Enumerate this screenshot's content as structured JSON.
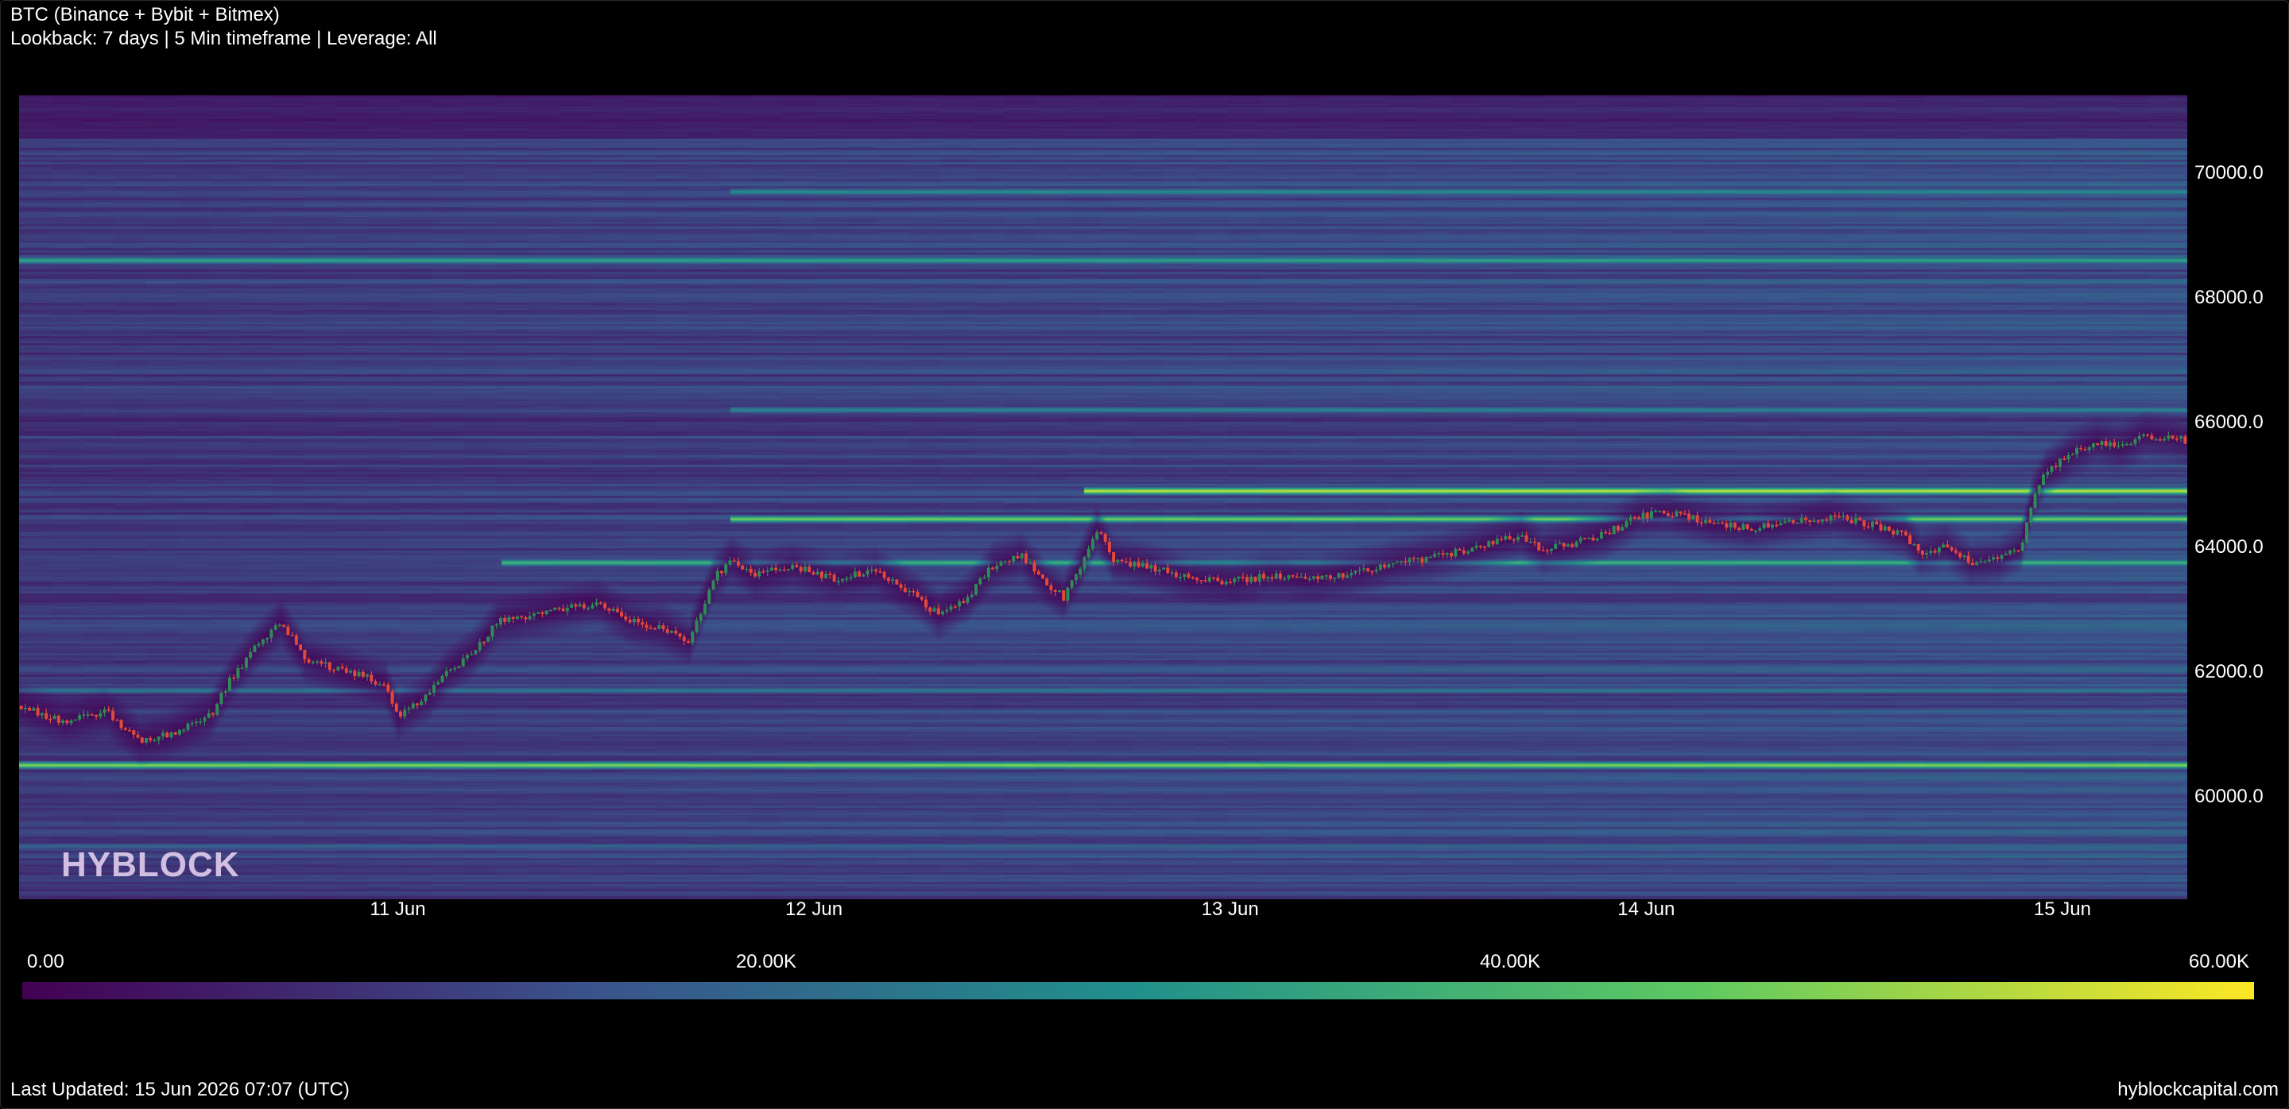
{
  "header": {
    "title": "BTC (Binance + Bybit + Bitmex)",
    "subtitle": "Lookback: 7 days | 5 Min timeframe | Leverage: All"
  },
  "brand": {
    "watermark": "HYBLOCK",
    "site": "hyblockcapital.com"
  },
  "footer": {
    "last_updated": "Last Updated: 15 Jun 2026 07:07 (UTC)"
  },
  "colors": {
    "background": "#000000",
    "scale": [
      "#440154",
      "#3b528b",
      "#21918c",
      "#5ec962",
      "#fde725"
    ],
    "candle_up": "#2e8b57",
    "candle_down": "#e04a3a"
  },
  "chart_data": {
    "type": "heatmap",
    "title": "BTC (Binance + Bybit + Bitmex)",
    "subtitle": "Lookback: 7 days | 5 Min timeframe | Leverage: All",
    "x_ticks": [
      "11 Jun",
      "12 Jun",
      "13 Jun",
      "14 Jun",
      "15 Jun"
    ],
    "x_tick_days": [
      11,
      12,
      13,
      14,
      15
    ],
    "xlim_days": [
      10.09,
      15.3
    ],
    "y_ticks": [
      "70000.0",
      "68000.0",
      "66000.0",
      "64000.0",
      "62000.0",
      "60000.0"
    ],
    "y_tick_values": [
      70000,
      68000,
      66000,
      64000,
      62000,
      60000
    ],
    "ylim": [
      58350,
      71250
    ],
    "y_axis_position": "right",
    "grid": false,
    "colorbar": {
      "min": 0,
      "max": 60000,
      "ticks": [
        "0.00",
        "20.00K",
        "40.00K",
        "60.00K"
      ],
      "tick_values": [
        0,
        20000,
        40000,
        60000
      ],
      "colormap": "viridis",
      "placement": "bottom"
    },
    "price_path": [
      [
        10.09,
        61450
      ],
      [
        10.2,
        61200
      ],
      [
        10.3,
        61350
      ],
      [
        10.38,
        60900
      ],
      [
        10.45,
        61000
      ],
      [
        10.55,
        61300
      ],
      [
        10.6,
        61900
      ],
      [
        10.66,
        62400
      ],
      [
        10.72,
        62800
      ],
      [
        10.78,
        62200
      ],
      [
        10.88,
        62000
      ],
      [
        10.97,
        61800
      ],
      [
        11.0,
        61300
      ],
      [
        11.07,
        61600
      ],
      [
        11.12,
        62000
      ],
      [
        11.18,
        62300
      ],
      [
        11.24,
        62800
      ],
      [
        11.32,
        62900
      ],
      [
        11.4,
        63000
      ],
      [
        11.48,
        63100
      ],
      [
        11.56,
        62800
      ],
      [
        11.64,
        62700
      ],
      [
        11.7,
        62500
      ],
      [
        11.76,
        63500
      ],
      [
        11.8,
        63800
      ],
      [
        11.86,
        63550
      ],
      [
        11.95,
        63700
      ],
      [
        12.05,
        63500
      ],
      [
        12.15,
        63600
      ],
      [
        12.25,
        63200
      ],
      [
        12.3,
        62900
      ],
      [
        12.37,
        63200
      ],
      [
        12.43,
        63700
      ],
      [
        12.5,
        63850
      ],
      [
        12.56,
        63400
      ],
      [
        12.6,
        63200
      ],
      [
        12.64,
        63700
      ],
      [
        12.68,
        64300
      ],
      [
        12.72,
        63800
      ],
      [
        12.8,
        63700
      ],
      [
        12.9,
        63500
      ],
      [
        13.0,
        63450
      ],
      [
        13.1,
        63550
      ],
      [
        13.2,
        63500
      ],
      [
        13.3,
        63600
      ],
      [
        13.4,
        63750
      ],
      [
        13.5,
        63850
      ],
      [
        13.6,
        64000
      ],
      [
        13.7,
        64200
      ],
      [
        13.75,
        63950
      ],
      [
        13.82,
        64050
      ],
      [
        13.9,
        64200
      ],
      [
        13.94,
        64350
      ],
      [
        13.98,
        64500
      ],
      [
        14.05,
        64550
      ],
      [
        14.15,
        64400
      ],
      [
        14.25,
        64300
      ],
      [
        14.35,
        64400
      ],
      [
        14.45,
        64500
      ],
      [
        14.55,
        64350
      ],
      [
        14.62,
        64200
      ],
      [
        14.66,
        63900
      ],
      [
        14.72,
        64000
      ],
      [
        14.78,
        63750
      ],
      [
        14.85,
        63800
      ],
      [
        14.9,
        64000
      ],
      [
        14.93,
        64800
      ],
      [
        14.96,
        65200
      ],
      [
        15.02,
        65500
      ],
      [
        15.08,
        65700
      ],
      [
        15.14,
        65600
      ],
      [
        15.2,
        65800
      ],
      [
        15.26,
        65750
      ],
      [
        15.3,
        65700
      ]
    ],
    "liquidation_bands": [
      {
        "price": 60500,
        "value": 50000,
        "from_day": 10.09
      },
      {
        "price": 64900,
        "value": 57000,
        "from_day": 12.65
      },
      {
        "price": 64450,
        "value": 48000,
        "from_day": 11.8
      },
      {
        "price": 63750,
        "value": 40000,
        "from_day": 11.25
      },
      {
        "price": 68600,
        "value": 36000,
        "from_day": 10.09
      },
      {
        "price": 69700,
        "value": 30000,
        "from_day": 11.8
      },
      {
        "price": 66200,
        "value": 28000,
        "from_day": 11.8
      },
      {
        "price": 61700,
        "value": 25000,
        "from_day": 10.09
      },
      {
        "price": 59200,
        "value": 20000,
        "from_day": 10.09
      }
    ]
  }
}
